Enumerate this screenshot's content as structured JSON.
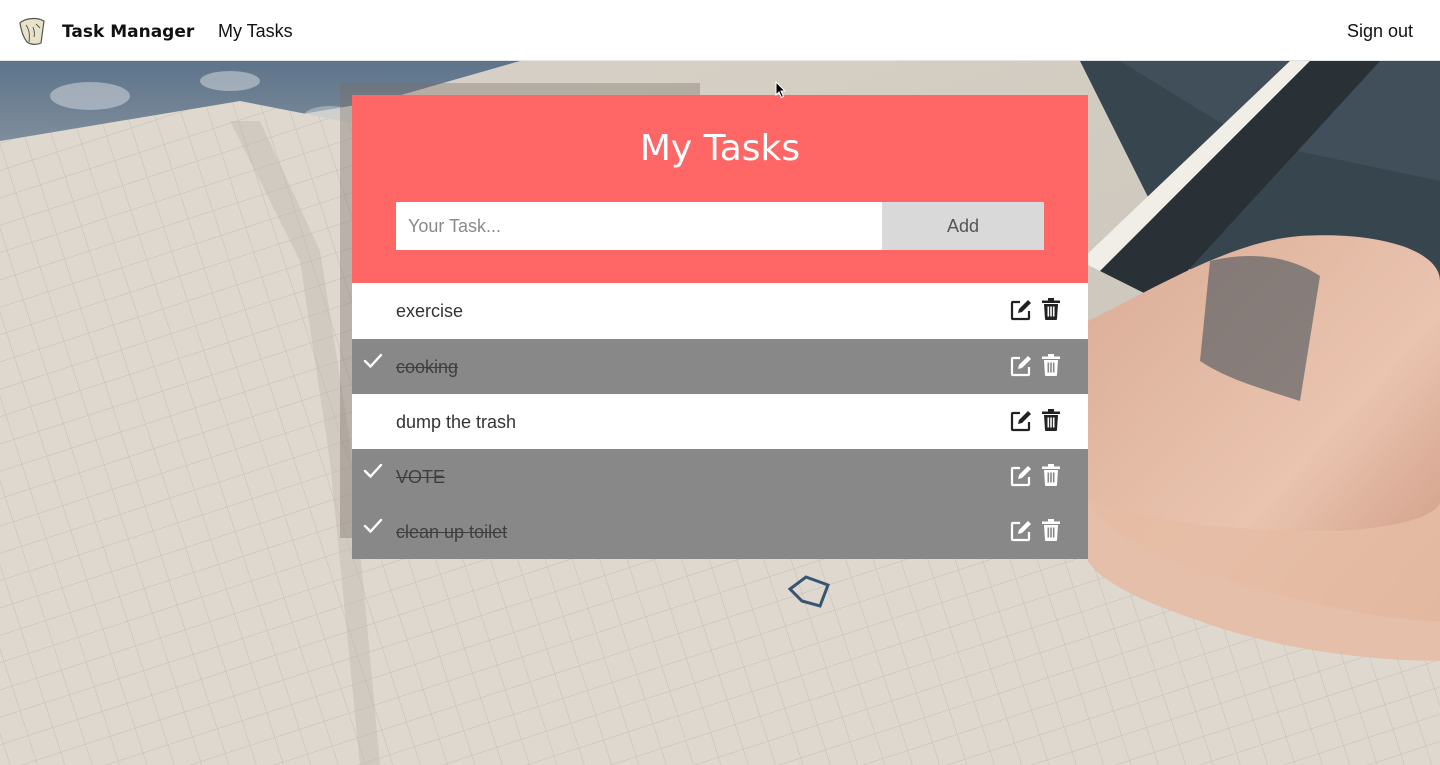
{
  "navbar": {
    "brand": "Task Manager",
    "links": [
      "My Tasks"
    ],
    "sign_out": "Sign out",
    "logo_icon": "feather-logo-icon"
  },
  "card": {
    "title": "My Tasks",
    "input_placeholder": "Your Task...",
    "input_value": "",
    "add_label": "Add",
    "header_color": "#ff6666"
  },
  "tasks": [
    {
      "text": "exercise",
      "done": false
    },
    {
      "text": "cooking",
      "done": true
    },
    {
      "text": "dump the trash",
      "done": false
    },
    {
      "text": "VOTE",
      "done": true
    },
    {
      "text": "clean up toilet",
      "done": true
    }
  ],
  "icons": {
    "check": "check-icon",
    "edit": "edit-icon",
    "delete": "trash-icon"
  },
  "colors": {
    "done_row": "#888888",
    "active_row": "#ffffff",
    "icon_dark": "#222222",
    "icon_light": "#ffffff"
  }
}
